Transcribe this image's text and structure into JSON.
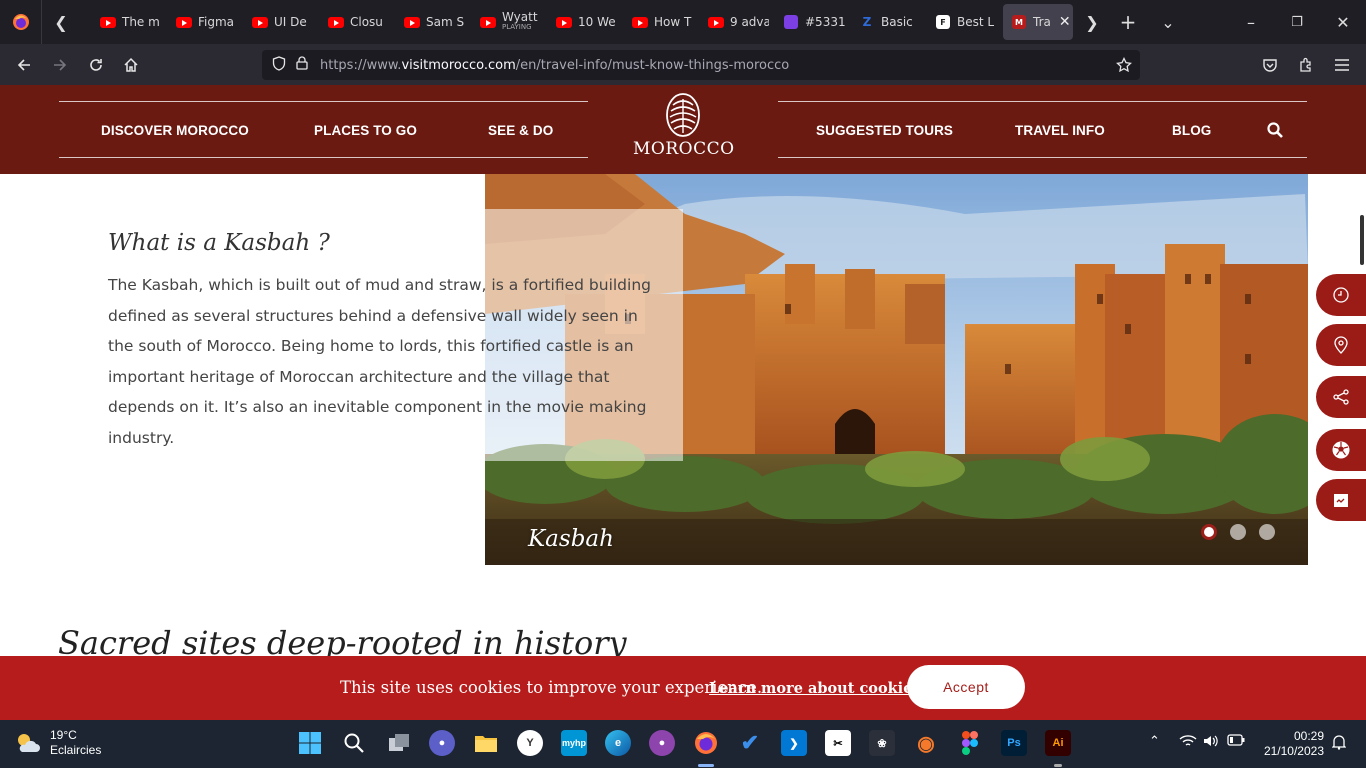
{
  "browser": {
    "tabs": [
      {
        "title": "The m",
        "icon": "youtube-icon"
      },
      {
        "title": "Figma",
        "icon": "youtube-icon"
      },
      {
        "title": "UI De",
        "icon": "youtube-icon"
      },
      {
        "title": "Closu",
        "icon": "youtube-icon"
      },
      {
        "title": "Sam S",
        "icon": "youtube-icon"
      },
      {
        "title": "Wyatt",
        "subtitle": "PLAYING",
        "icon": "youtube-icon"
      },
      {
        "title": "10 We",
        "icon": "youtube-icon"
      },
      {
        "title": "How T",
        "icon": "youtube-icon"
      },
      {
        "title": "9 adva",
        "icon": "youtube-icon"
      },
      {
        "title": "#5331",
        "icon": "purple-square-icon"
      },
      {
        "title": "Basic",
        "icon": "zb-icon"
      },
      {
        "title": "Best L",
        "icon": "fol-icon"
      },
      {
        "title": "Tra",
        "icon": "visitmorocco-icon",
        "active": true
      }
    ],
    "url_prefix": "https://www.",
    "url_domain": "visitmorocco.com",
    "url_path": "/en/travel-info/must-know-things-morocco"
  },
  "site": {
    "nav_left": [
      "DISCOVER MOROCCO",
      "PLACES TO GO",
      "SEE & DO"
    ],
    "nav_right": [
      "SUGGESTED TOURS",
      "TRAVEL INFO",
      "BLOG"
    ],
    "logo_text": "MOROCCO",
    "brand_color": "#6b1a12",
    "accent_color": "#b71c1c"
  },
  "article": {
    "kasbah_title": "What is a Kasbah ?",
    "kasbah_body": "The Kasbah, which is built out of mud and straw, is a fortified building defined as several structures behind a defensive wall widely seen in the south of Morocco. Being home to lords, this fortified castle is an important heritage of Moroccan architecture and the village that depends on it. It’s also an inevitable component in the movie making industry.",
    "slide_caption": "Kasbah",
    "slide_count": 3,
    "active_slide": 1,
    "next_heading": "Sacred sites deep-rooted in history"
  },
  "side_buttons": [
    "clock-icon",
    "map-pin-icon",
    "share-icon",
    "football-icon",
    "calendar-icon"
  ],
  "cookie": {
    "text": "This site uses cookies to improve your experience.",
    "link": "Learn more about cookies.",
    "accept": "Accept"
  },
  "taskbar": {
    "temperature": "19°C",
    "weather": "Eclaircies",
    "time": "00:29",
    "date": "21/10/2023"
  }
}
